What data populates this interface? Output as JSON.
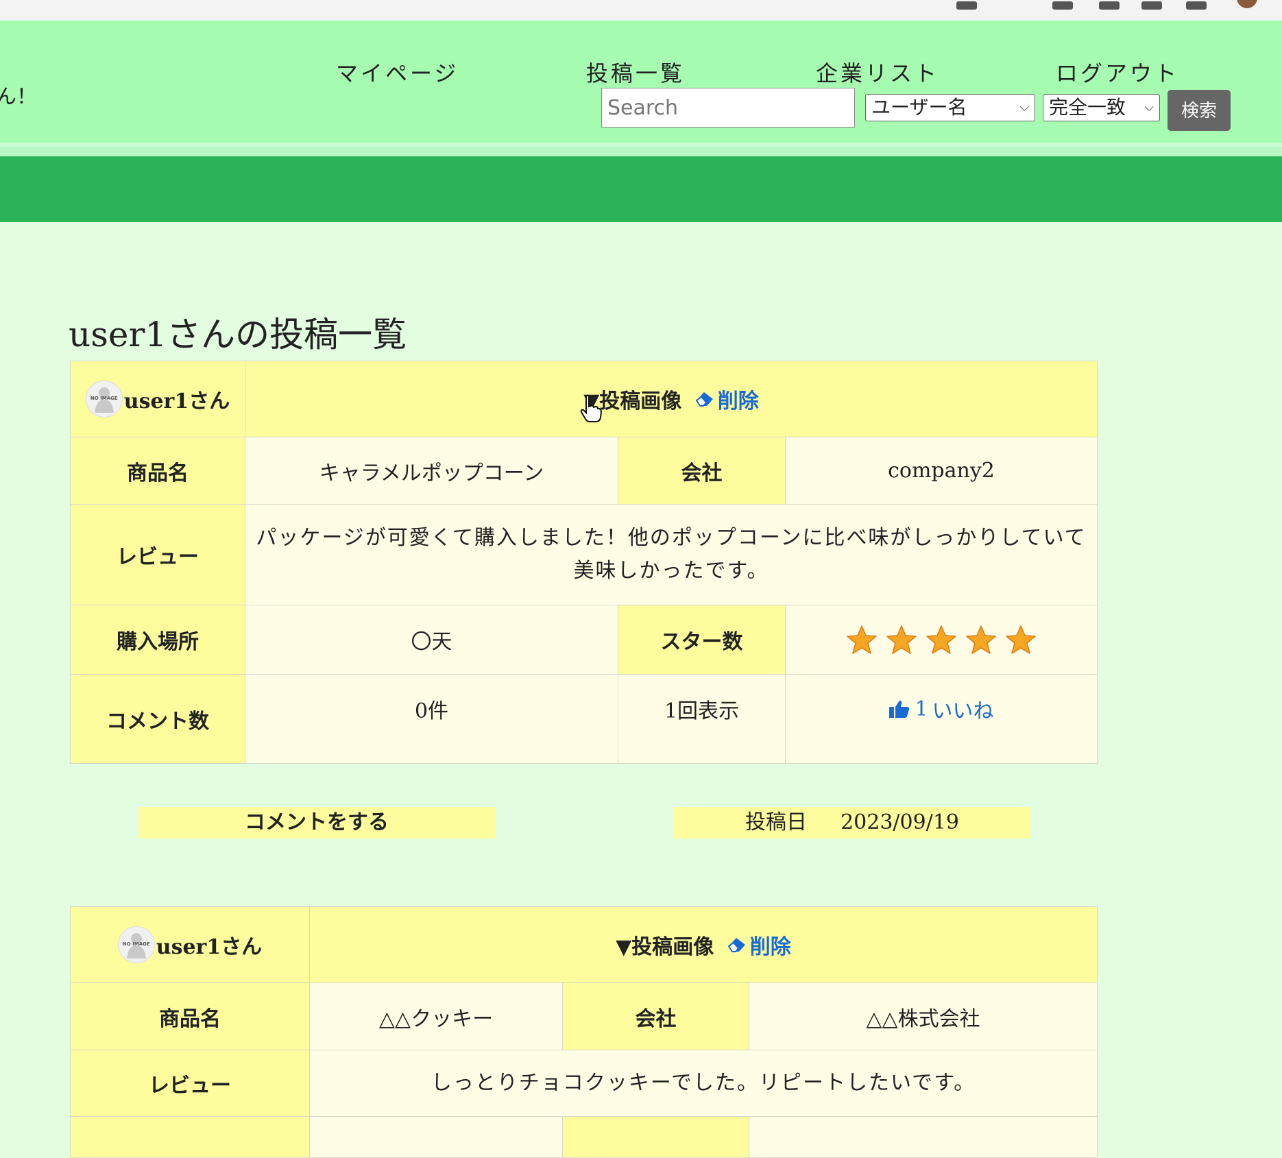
{
  "header": {
    "greeting": "ん！",
    "nav": [
      "マイページ",
      "投稿一覧",
      "企業リスト",
      "ログアウト"
    ],
    "search_placeholder": "Search",
    "search_type": "ユーザー名",
    "match_type": "完全一致",
    "search_button": "検索"
  },
  "page_title": "user1さんの投稿一覧",
  "labels": {
    "image_toggle": "▼投稿画像",
    "delete": "削除",
    "product": "商品名",
    "company": "会社",
    "review": "レビュー",
    "purchase_place": "購入場所",
    "star_count": "スター数",
    "comment_count": "コメント数",
    "comment_action": "コメントをする",
    "post_date_label": "投稿日",
    "like_suffix": "いいね",
    "avatar_text": "NO IMAGE"
  },
  "posts": [
    {
      "user": "user1さん",
      "product": "キャラメルポップコーン",
      "company": "company2",
      "review": "パッケージが可愛くて購入しました！他のポップコーンに比べ味がしっかりしていて美味しかったです。",
      "purchase_place": "〇天",
      "stars": 5,
      "comments": "0件",
      "views": "1回表示",
      "likes": "1",
      "date": "2023/09/19"
    },
    {
      "user": "user1さん",
      "product": "△△クッキー",
      "company": "△△株式会社",
      "review": "しっとりチョコクッキーでした。リピートしたいです。"
    }
  ],
  "colors": {
    "header_bg": "#a6fdb1",
    "band": "#2db357",
    "page_bg": "#e3fde1",
    "cell_header": "#fefd9d",
    "cell_value": "#fffde5",
    "link": "#1a6ad6",
    "star": "#f5a623"
  }
}
